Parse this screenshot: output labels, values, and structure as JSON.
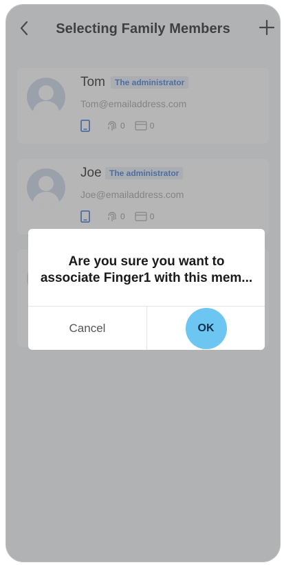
{
  "header": {
    "title": "Selecting Family Members"
  },
  "members": [
    {
      "name": "Tom",
      "role": "The administrator",
      "email": "Tom@emailaddress.com",
      "fingerprints": "0",
      "cards": "0"
    },
    {
      "name": "Joe",
      "role": "The administrator",
      "email": "Joe@emailaddress.com",
      "fingerprints": "0",
      "cards": "0"
    }
  ],
  "dialog": {
    "message_line1": "Are you sure you want to",
    "message_line2": "associate Finger1 with this mem...",
    "cancel_label": "Cancel",
    "ok_label": "OK"
  },
  "icons": {
    "back": "chevron-left-icon",
    "add": "plus-icon",
    "phone": "phone-icon",
    "fingerprint": "fingerprint-icon",
    "card": "card-icon"
  },
  "colors": {
    "accent": "#6cc6f1",
    "badge_text": "#2d6fcf",
    "badge_bg": "#e6eef8",
    "overlay": "rgba(110,110,110,0.5)"
  }
}
